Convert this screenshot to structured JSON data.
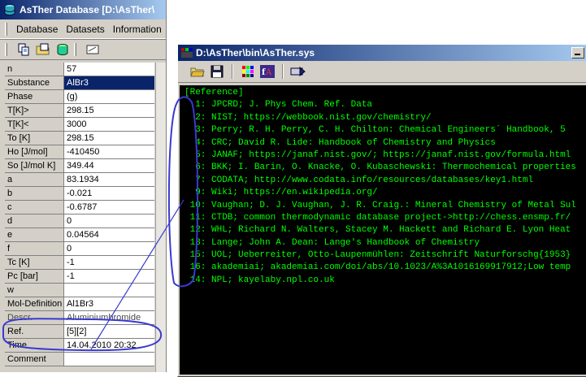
{
  "main_window": {
    "title": "AsTher Database [D:\\AsTher\\",
    "menu": [
      "Database",
      "Datasets",
      "Information"
    ]
  },
  "fields": [
    {
      "label": "n",
      "value": "57"
    },
    {
      "label": "Substance",
      "value": "AlBr3"
    },
    {
      "label": "Phase",
      "value": "(g)"
    },
    {
      "label": "T[K]>",
      "value": "298.15"
    },
    {
      "label": "T[K]<",
      "value": "3000"
    },
    {
      "label": "To [K]",
      "value": "298.15"
    },
    {
      "label": "Ho [J/mol]",
      "value": "-410450"
    },
    {
      "label": "So [J/mol K]",
      "value": "349.44"
    },
    {
      "label": "a",
      "value": "83.1934"
    },
    {
      "label": "b",
      "value": "-0.021"
    },
    {
      "label": "c",
      "value": "-0.6787"
    },
    {
      "label": "d",
      "value": "0"
    },
    {
      "label": "e",
      "value": "0.04564"
    },
    {
      "label": "f",
      "value": "0"
    },
    {
      "label": "Tc [K]",
      "value": "-1"
    },
    {
      "label": "Pc [bar]",
      "value": "-1"
    },
    {
      "label": "w",
      "value": ""
    },
    {
      "label": "Mol-Definition",
      "value": "Al1Br3"
    },
    {
      "label": "Descr.",
      "value": "Aluminiumbromide"
    },
    {
      "label": "Ref.",
      "value": "[5][2]"
    },
    {
      "label": "Time",
      "value": "14.04.2010 20:32"
    },
    {
      "label": "Comment",
      "value": ""
    }
  ],
  "sys_window": {
    "title": "D:\\AsTher\\bin\\AsTher.sys",
    "lines": [
      "[Reference]",
      "  1: JPCRD; J. Phys Chem. Ref. Data",
      "  2: NIST; https://webbook.nist.gov/chemistry/",
      "  3: Perry; R. H. Perry, C. H. Chilton: Chemical Engineers´ Handbook, 5",
      "  4: CRC; David R. Lide: Handbook of Chemistry and Physics",
      "  5: JANAF; https://janaf.nist.gov/; https://janaf.nist.gov/formula.html",
      "  6: BKK; I. Barin, O. Knacke, O. Kubaschewski: Thermochemical properties",
      "  7: CODATA; http://www.codata.info/resources/databases/key1.html",
      "  9: Wiki; https://en.wikipedia.org/",
      " 10: Vaughan; D. J. Vaughan, J. R. Craig.: Mineral Chemistry of Metal Sul",
      " 11: CTDB; common thermodynamic database project->http://chess.ensmp.fr/",
      " 12: WHL; Richard N. Walters, Stacey M. Hackett and Richard E. Lyon Heat",
      " 13: Lange; John A. Dean: Lange's Handbook of Chemistry",
      " 15: UOL; Ueberreiter, Otto-Laupenmühlen: Zeitschrift Naturforschg{1953}",
      " 16: akademiai; akademiai.com/doi/abs/10.1023/A%3A1016169917912;Low temp",
      " 14: NPL; kayelaby.npl.co.uk"
    ]
  },
  "colors": {
    "terminal_text": "#00ff00",
    "annotation": "#3a3ad0",
    "selection": "#0a246a"
  }
}
